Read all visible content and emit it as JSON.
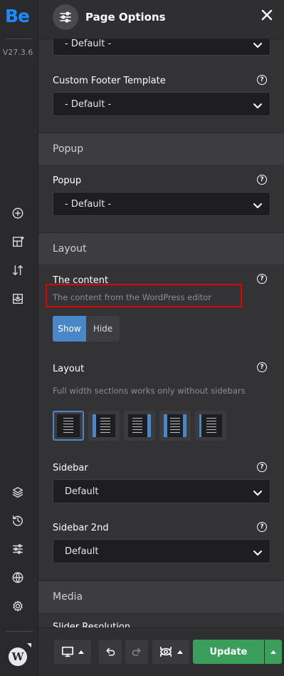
{
  "rail": {
    "logo": "Be",
    "version": "V27.3.6",
    "icons": [
      "add-circle-icon",
      "layout-add-icon",
      "sort-arrows-icon",
      "import-icon",
      "layers-icon",
      "history-icon",
      "sliders-icon",
      "globe-icon",
      "settings-icon",
      "wordpress-icon"
    ],
    "wp_glyph": "W"
  },
  "header": {
    "title": "Page Options",
    "icon": "sliders-icon"
  },
  "fields": {
    "top_select": {
      "value": "- Default -"
    },
    "custom_footer": {
      "label": "Custom Footer Template",
      "value": "- Default -"
    },
    "popup": {
      "label": "Popup",
      "value": "- Default -"
    },
    "the_content": {
      "label": "The content",
      "description": "The content from the WordPress editor",
      "options": [
        "Show",
        "Hide"
      ],
      "selected": "Show"
    },
    "layout": {
      "label": "Layout",
      "description": "Full width sections works only without sidebars",
      "options": [
        "full-width",
        "left-sidebar",
        "right-sidebar",
        "both-sidebars",
        "left-sidebar-alt"
      ],
      "selected": "full-width"
    },
    "sidebar": {
      "label": "Sidebar",
      "value": "Default"
    },
    "sidebar_2nd": {
      "label": "Sidebar 2nd",
      "value": "Default"
    },
    "slider_resolution": {
      "label": "Slider Resolution"
    }
  },
  "sections": {
    "popup": "Popup",
    "layout": "Layout",
    "media": "Media"
  },
  "help_glyph": "?",
  "footer": {
    "update_label": "Update",
    "accent": "#3b9f5c"
  },
  "colors": {
    "accent_blue": "#4a87c9",
    "highlight_red": "#e00000",
    "logo_blue": "#1a8cff"
  }
}
